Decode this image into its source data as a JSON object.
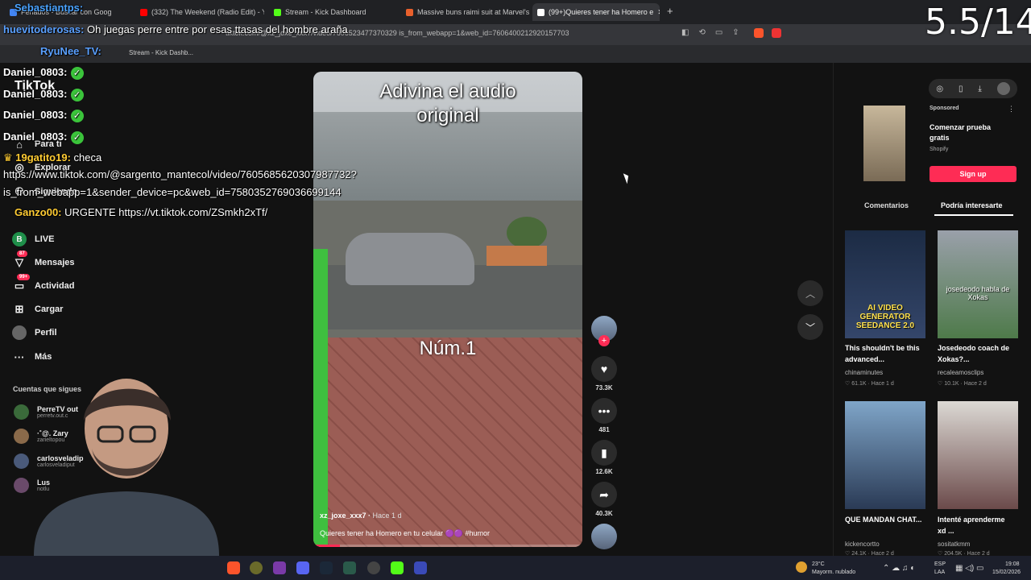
{
  "browser": {
    "tabs": [
      {
        "label": "Feriados - Buscar con Goog",
        "color": "#4285f4"
      },
      {
        "label": "(332) The Weekend (Radio Edit) - Yo",
        "color": "#ff0000"
      },
      {
        "label": "Stream - Kick Dashboard",
        "color": "#53fc18"
      },
      {
        "label": "Massive buns raimi suit at Marvel's S",
        "color": "#e8602c"
      },
      {
        "label": "(99+)Quieres tener ha Homero e",
        "color": "#ffffff",
        "active": true
      }
    ],
    "url": "tiktok.com/@xz_joxe_xxx7/video/7606523477370329 is_from_webapp=1&web_id=7606400212920157703",
    "bookmark": "Stream - Kick Dashb..."
  },
  "overlay": {
    "counter": "5.5/14",
    "chat": [
      {
        "user": "Sebastiantps:",
        "text": ""
      },
      {
        "user": "huevitoderosas:",
        "text": " Oh  juegas perre entre por esas ttasas del hombre araña"
      },
      {
        "user": "RyuNee_TV:",
        "text": ""
      },
      {
        "user": "Daniel_0803:",
        "text": "",
        "ok": true
      },
      {
        "user": "Daniel_0803:",
        "text": "",
        "ok": true
      },
      {
        "user": "Daniel_0803:",
        "text": "",
        "ok": true
      },
      {
        "user": "Daniel_0803:",
        "text": "",
        "ok": true
      },
      {
        "user": "19gatito19:",
        "text": " checa"
      },
      {
        "user": "",
        "text": "https://www.tiktok.com/@sargento_mantecol/video/7605685620307987732?"
      },
      {
        "user": "",
        "text": "is_from_webapp=1&sender_device=pc&web_id=7580352769036699144"
      },
      {
        "user": "Ganzo00:",
        "text": " URGENTE  https://vt.tiktok.com/ZSmkh2xTf/"
      }
    ]
  },
  "sidebar": {
    "logo": "TikTok",
    "nav": [
      {
        "label": "Para ti",
        "icon": "home-icon"
      },
      {
        "label": "Explorar",
        "icon": "compass-icon"
      },
      {
        "label": "Siguiendo",
        "icon": "following-icon"
      },
      {
        "label": "LIVE",
        "icon": "live-icon"
      },
      {
        "label": "Mensajes",
        "icon": "message-icon",
        "badge": "87"
      },
      {
        "label": "Actividad",
        "icon": "activity-icon",
        "badge": "99+"
      },
      {
        "label": "Cargar",
        "icon": "upload-icon"
      },
      {
        "label": "Perfil",
        "icon": "profile-icon"
      },
      {
        "label": "Más",
        "icon": "more-icon"
      }
    ],
    "following_title": "Cuentas que sigues",
    "following": [
      {
        "name": "PerreTV out",
        "handle": "perretv.out.c"
      },
      {
        "name": "·˚@. Zary",
        "handle": "zarieltopou"
      },
      {
        "name": "carlosveladip",
        "handle": "carlosveladiput"
      },
      {
        "name": "Lus",
        "handle": "notlu"
      }
    ]
  },
  "video": {
    "title": "Adivina el audio original",
    "label": "Núm.1",
    "author": "xz_joxe_xxx7",
    "time": "Hace 1 d",
    "caption": "Quieres tener ha Homero en tu celular 🟣🟣 #humor",
    "progress": 0.1,
    "likes": "73.3K",
    "comments": "481",
    "saves": "12.6K",
    "shares": "40.3K"
  },
  "right": {
    "ad": {
      "sponsored": "Sponsored",
      "title": "Comenzar prueba gratis",
      "brand": "Shopify",
      "button": "Sign up"
    },
    "tabs": [
      "Comentarios",
      "Podría interesarte"
    ],
    "recs": [
      {
        "title": "This shouldn't be this advanced...",
        "author": "chinaminutes",
        "likes": "61.1K",
        "time": "Hace 1 d",
        "overlay": "AI VIDEO GENERATOR",
        "overlay2": "SEEDANCE 2.0"
      },
      {
        "title": "Josedeodo coach de Xokas?...",
        "author": "recaleamosclips",
        "likes": "10.1K",
        "time": "Hace 2 d",
        "overlay": "josedeodo habla de Xokas",
        "overlay2": ""
      },
      {
        "title": "QUE MANDAN CHAT...",
        "author": "kickencortto",
        "likes": "24.1K",
        "time": "Hace 2 d",
        "overlay": "",
        "overlay2": ""
      },
      {
        "title": "Intenté aprenderme xd ...",
        "author": "sositatkmm",
        "likes": "204.5K",
        "time": "Hace 2 d",
        "overlay": "",
        "overlay2": ""
      }
    ]
  },
  "taskbar": {
    "weather_temp": "23°C",
    "weather_text": "Mayorm. nublado",
    "lang": "ESP",
    "lang2": "LAA",
    "time": "19:08",
    "date": "15/02/2026"
  }
}
